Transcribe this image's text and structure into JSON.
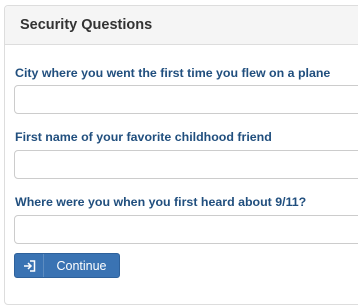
{
  "panel": {
    "title": "Security Questions"
  },
  "questions": [
    {
      "label": "City where you went the first time you flew on a plane",
      "value": ""
    },
    {
      "label": "First name of your favorite childhood friend",
      "value": ""
    },
    {
      "label": "Where were you when you first heard about 9/11?",
      "value": ""
    }
  ],
  "actions": {
    "continue_label": "Continue",
    "continue_icon": "sign-in-icon"
  },
  "colors": {
    "label": "#214f7e",
    "button": "#3a73b3",
    "heading_bg": "#f5f5f5"
  }
}
